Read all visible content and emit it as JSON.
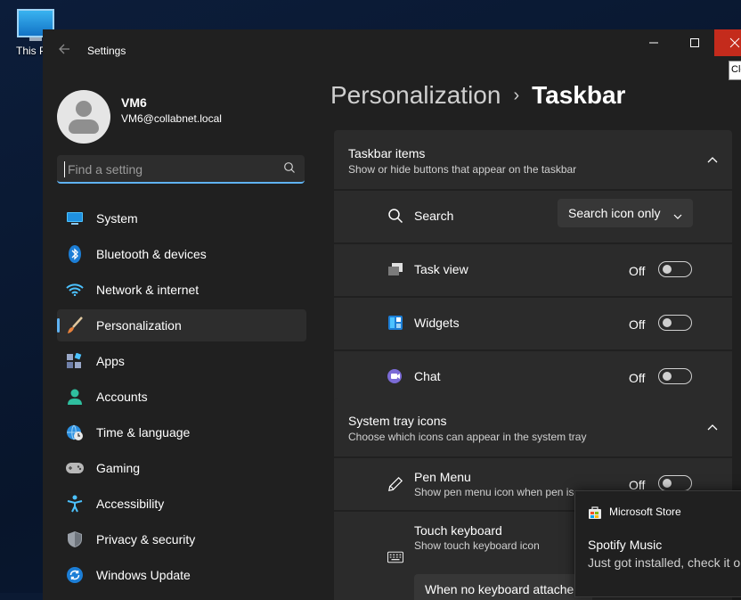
{
  "desktop": {
    "icon_label": "This PC"
  },
  "window": {
    "title": "Settings",
    "tooltip": "Close"
  },
  "profile": {
    "name": "VM6",
    "email": "VM6@collabnet.local"
  },
  "search": {
    "placeholder": "Find a setting"
  },
  "sidebar": {
    "items": [
      {
        "label": "System",
        "icon": "monitor-icon"
      },
      {
        "label": "Bluetooth & devices",
        "icon": "bluetooth-icon"
      },
      {
        "label": "Network & internet",
        "icon": "wifi-icon"
      },
      {
        "label": "Personalization",
        "icon": "brush-icon",
        "active": true
      },
      {
        "label": "Apps",
        "icon": "apps-icon"
      },
      {
        "label": "Accounts",
        "icon": "person-icon"
      },
      {
        "label": "Time & language",
        "icon": "globe-clock-icon"
      },
      {
        "label": "Gaming",
        "icon": "gamepad-icon"
      },
      {
        "label": "Accessibility",
        "icon": "accessibility-icon"
      },
      {
        "label": "Privacy & security",
        "icon": "shield-icon"
      },
      {
        "label": "Windows Update",
        "icon": "update-icon"
      }
    ]
  },
  "breadcrumb": {
    "parent": "Personalization",
    "separator": "›",
    "current": "Taskbar"
  },
  "taskbar_items": {
    "title": "Taskbar items",
    "description": "Show or hide buttons that appear on the taskbar",
    "search": {
      "label": "Search",
      "value": "Search icon only"
    },
    "task_view": {
      "label": "Task view",
      "state": "Off"
    },
    "widgets": {
      "label": "Widgets",
      "state": "Off"
    },
    "chat": {
      "label": "Chat",
      "state": "Off"
    }
  },
  "system_tray": {
    "title": "System tray icons",
    "description": "Choose which icons can appear in the system tray",
    "pen_menu": {
      "label": "Pen Menu",
      "sub": "Show pen menu icon when pen is",
      "state": "Off"
    },
    "touch_keyboard": {
      "label": "Touch keyboard",
      "sub": "Show touch keyboard icon",
      "dropdown": "When no keyboard attache"
    }
  },
  "toast": {
    "app": "Microsoft Store",
    "title": "Spotify Music",
    "body": "Just got installed, check it o"
  },
  "colors": {
    "accent": "#5fb2f2",
    "close_red": "#c42b1c",
    "panel": "#2b2b2b",
    "window_bg": "#202020"
  }
}
